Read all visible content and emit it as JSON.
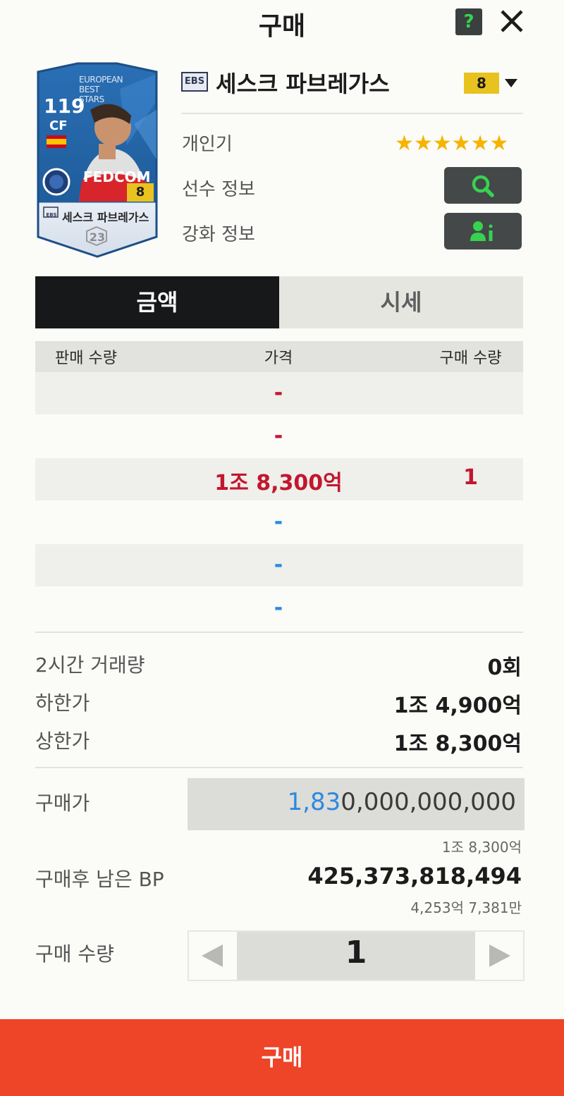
{
  "header": {
    "title": "구매",
    "help_label": "?"
  },
  "card": {
    "ovr": "119",
    "position": "CF",
    "season_lines": [
      "EUROPEAN",
      "BEST STARS"
    ],
    "grade": "8",
    "name": "세스크 파브레가스",
    "badge": "EBS",
    "number": "23",
    "shirt_text": "FEDCOM"
  },
  "player": {
    "badge": "EBS",
    "name": "세스크 파브레가스",
    "grade": "8",
    "popularity_label": "개인기",
    "popularity_stars": "★★★★★★",
    "player_info_label": "선수 정보",
    "enhance_info_label": "강화 정보"
  },
  "tabs": [
    {
      "label": "금액"
    },
    {
      "label": "시세"
    }
  ],
  "table": {
    "headers": [
      "판매 수량",
      "가격",
      "구매 수량"
    ],
    "rows": [
      {
        "sell_qty": "",
        "price": "-",
        "buy_qty": ""
      },
      {
        "sell_qty": "",
        "price": "-",
        "buy_qty": ""
      },
      {
        "sell_qty": "",
        "price": "1조 8,300억",
        "buy_qty": "1"
      },
      {
        "sell_qty": "",
        "price": "-",
        "buy_qty": ""
      },
      {
        "sell_qty": "",
        "price": "-",
        "buy_qty": ""
      },
      {
        "sell_qty": "",
        "price": "-",
        "buy_qty": ""
      }
    ]
  },
  "stats": {
    "volume_label": "2시간 거래량",
    "volume_value": "0회",
    "lower_label": "하한가",
    "lower_value": "1조 4,900억",
    "upper_label": "상한가",
    "upper_value": "1조 8,300억"
  },
  "purchase": {
    "price_label": "구매가",
    "price_highlight": "1,83",
    "price_rest": "0,000,000,000",
    "price_short": "1조 8,300억",
    "remaining_label": "구매후 남은 BP",
    "remaining_value": "425,373,818,494",
    "remaining_short": "4,253억 7,381만",
    "qty_label": "구매 수량",
    "qty_value": "1"
  },
  "buy_button": {
    "label": "구매"
  },
  "colors": {
    "accent": "#ee4428",
    "price_red": "#c2172e",
    "price_blue": "#2b8ae0",
    "grade_gold": "#e8c21e",
    "help_green": "#36d34f"
  }
}
